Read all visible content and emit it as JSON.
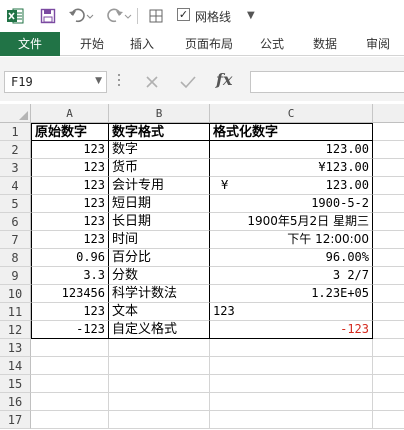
{
  "app": {
    "icon": "excel-icon"
  },
  "quick_access": {
    "items": [
      "save-icon",
      "undo-icon",
      "redo-icon",
      "border-icon"
    ],
    "gridlines_checked": true,
    "gridlines_label": "网格线"
  },
  "ribbon": {
    "tabs": [
      {
        "label": "文件",
        "active": true
      },
      {
        "label": "开始"
      },
      {
        "label": "插入"
      },
      {
        "label": "页面布局"
      },
      {
        "label": "公式"
      },
      {
        "label": "数据"
      },
      {
        "label": "审阅"
      }
    ]
  },
  "formula_bar": {
    "name_box": "F19",
    "fx_label": "fx",
    "formula": ""
  },
  "sheet": {
    "columns": [
      "A",
      "B",
      "C"
    ],
    "rows": [
      {
        "num": "1",
        "a": "原始数字",
        "b": "数字格式",
        "c": "格式化数字"
      },
      {
        "num": "2",
        "a": "123",
        "b": "数字",
        "c": "123.00"
      },
      {
        "num": "3",
        "a": "123",
        "b": "货币",
        "c": "¥123.00"
      },
      {
        "num": "4",
        "a": "123",
        "b": "会计专用",
        "c_sym": "¥",
        "c": "123.00"
      },
      {
        "num": "5",
        "a": "123",
        "b": "短日期",
        "c": "1900-5-2"
      },
      {
        "num": "6",
        "a": "123",
        "b": "长日期",
        "c": "1900年5月2日 星期三"
      },
      {
        "num": "7",
        "a": "123",
        "b": "时间",
        "c": "下午 12:00:00"
      },
      {
        "num": "8",
        "a": "0.96",
        "b": "百分比",
        "c": "96.00%"
      },
      {
        "num": "9",
        "a": "3.3",
        "b": "分数",
        "c": "3 2/7"
      },
      {
        "num": "10",
        "a": "123456",
        "b": "科学计数法",
        "c": "1.23E+05"
      },
      {
        "num": "11",
        "a": "123",
        "b": "文本",
        "c": "123"
      },
      {
        "num": "12",
        "a": "-123",
        "b": "自定义格式",
        "c": "-123"
      },
      {
        "num": "13",
        "a": "",
        "b": "",
        "c": ""
      },
      {
        "num": "14",
        "a": "",
        "b": "",
        "c": ""
      },
      {
        "num": "15",
        "a": "",
        "b": "",
        "c": ""
      },
      {
        "num": "16",
        "a": "",
        "b": "",
        "c": ""
      },
      {
        "num": "17",
        "a": "",
        "b": "",
        "c": ""
      }
    ],
    "colors": {
      "negative": "#d42b20",
      "header_bg": "#f0f0f0",
      "file_tab": "#217346"
    }
  }
}
